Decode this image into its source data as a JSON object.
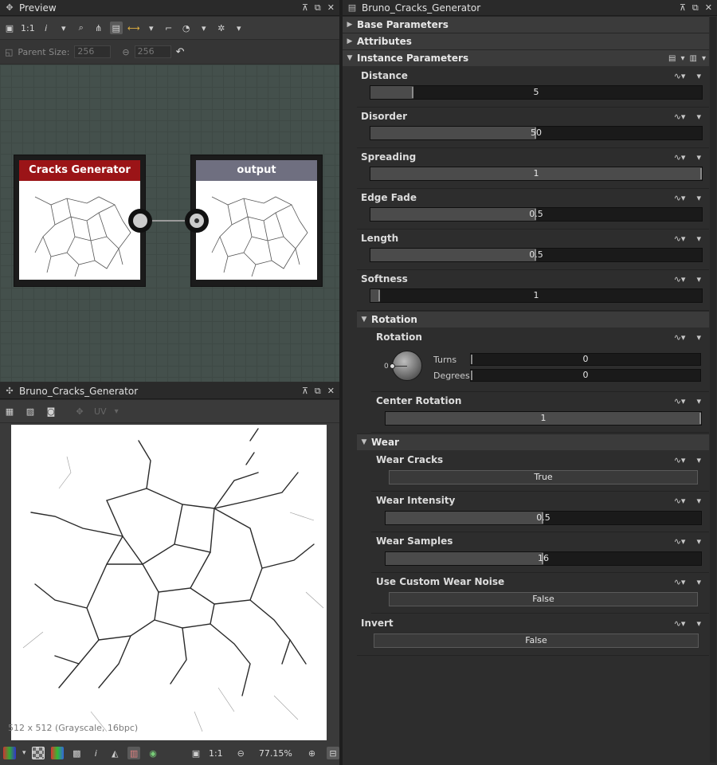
{
  "preview_panel": {
    "title": "Preview",
    "toolbar": {
      "ratio_label": "1:1",
      "info_label": "i"
    },
    "parent_size": {
      "label": "Parent Size:",
      "width": "256",
      "height": "256"
    },
    "nodes": [
      {
        "title": "Cracks Generator",
        "header_color": "#9b1417"
      },
      {
        "title": "output",
        "header_color": "#6f6f80"
      }
    ]
  },
  "viewer_panel": {
    "title": "Bruno_Cracks_Generator",
    "uv_label": "UV",
    "image_info": "512 x 512 (Grayscale, 16bpc)",
    "bottom": {
      "ratio_label": "1:1",
      "info_label": "i",
      "zoom": "77.15%"
    }
  },
  "params_panel": {
    "title": "Bruno_Cracks_Generator",
    "sections": {
      "base": "Base Parameters",
      "attributes": "Attributes",
      "instance": "Instance Parameters",
      "rotation": "Rotation",
      "wear": "Wear"
    },
    "params": {
      "distance": {
        "label": "Distance",
        "value": "5",
        "fill": 0.13
      },
      "disorder": {
        "label": "Disorder",
        "value": "50",
        "fill": 0.5
      },
      "spreading": {
        "label": "Spreading",
        "value": "1",
        "fill": 1.0
      },
      "edge_fade": {
        "label": "Edge Fade",
        "value": "0.5",
        "fill": 0.5
      },
      "length": {
        "label": "Length",
        "value": "0.5",
        "fill": 0.5
      },
      "softness": {
        "label": "Softness",
        "value": "1",
        "fill": 0.03
      },
      "rotation": {
        "label": "Rotation",
        "dial_zero": "0",
        "turns_label": "Turns",
        "turns": "0",
        "degrees_label": "Degrees",
        "degrees": "0"
      },
      "center_rotation": {
        "label": "Center Rotation",
        "value": "1",
        "fill": 1.0
      },
      "wear_cracks": {
        "label": "Wear Cracks",
        "value": "True"
      },
      "wear_intensity": {
        "label": "Wear Intensity",
        "value": "0.5",
        "fill": 0.5
      },
      "wear_samples": {
        "label": "Wear Samples",
        "value": "16",
        "fill": 0.5
      },
      "use_custom_wear_noise": {
        "label": "Use Custom Wear Noise",
        "value": "False"
      },
      "invert": {
        "label": "Invert",
        "value": "False"
      }
    }
  }
}
